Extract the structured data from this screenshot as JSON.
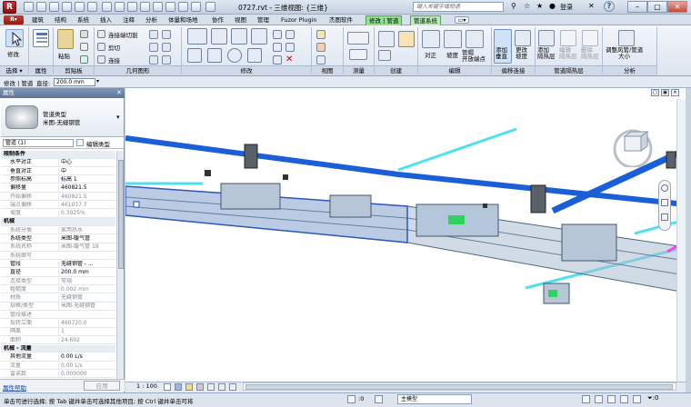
{
  "title_bar": {
    "doc_title": "0727.rvt - 三维视图: {三维}",
    "search_placeholder": "键入关键字或短语",
    "sign_in": "登录",
    "help": "?"
  },
  "tabs": [
    "建筑",
    "结构",
    "系统",
    "插入",
    "注释",
    "分析",
    "体量和场地",
    "协作",
    "视图",
    "管理",
    "Fuzor Plugin",
    "杰图软件",
    "修改 | 管道",
    "管道系统"
  ],
  "ribbon": {
    "panels": [
      {
        "label": "选择 ▾"
      },
      {
        "label": "属性"
      },
      {
        "label": "剪贴板"
      },
      {
        "label": "几何图形"
      },
      {
        "label": "修改"
      },
      {
        "label": "视图"
      },
      {
        "label": "测量"
      },
      {
        "label": "创建"
      },
      {
        "label": "编辑"
      },
      {
        "label": "偏移连接"
      },
      {
        "label": "管道隔热层"
      },
      {
        "label": "分析"
      }
    ],
    "modify_button": "修改",
    "properties_button": "属性",
    "clipboard_paste": "粘贴",
    "geometry": {
      "join_cut": "连接端切割",
      "cut": "剪切",
      "join": "连接"
    },
    "edit": {
      "justify": "对正",
      "slope": "坡度",
      "pipe_open_end": "管帽\n开放端点"
    },
    "offset": {
      "add_vertical": "添加\n垂直",
      "change_slope": "更改\n坡度"
    },
    "insulation": {
      "add": "添加\n隔热层",
      "edit": "编辑\n隔热层",
      "remove": "删除\n隔热层"
    },
    "analysis": {
      "resize": "调整风管/管道\n大小"
    }
  },
  "options_bar": {
    "context": "修改 | 管道",
    "diameter_label": "直径:",
    "diameter_value": "200.0 mm"
  },
  "properties": {
    "palette_title": "属性",
    "type_family": "管道类型",
    "type_name": "米图-无缝钢管",
    "filter_value": "管道 (1)",
    "edit_type": "编辑类型",
    "apply": "应用",
    "help_link": "属性帮助",
    "rows": [
      {
        "k": "限制条件",
        "v": "",
        "kind": "sect"
      },
      {
        "k": "水平对正",
        "v": "中心"
      },
      {
        "k": "垂直对正",
        "v": "中"
      },
      {
        "k": "参照标高",
        "v": "标高 1"
      },
      {
        "k": "偏移量",
        "v": "460821.5"
      },
      {
        "k": "开始偏移",
        "v": "460821.5",
        "kind": "grey"
      },
      {
        "k": "端点偏移",
        "v": "461037.7",
        "kind": "grey"
      },
      {
        "k": "坡度",
        "v": "0.3925%",
        "kind": "grey"
      },
      {
        "k": "机械",
        "v": "",
        "kind": "sect"
      },
      {
        "k": "系统分类",
        "v": "家用热水",
        "kind": "grey"
      },
      {
        "k": "系统类型",
        "v": "米图-暖气管"
      },
      {
        "k": "系统名称",
        "v": "米图-暖气管 18",
        "kind": "grey"
      },
      {
        "k": "系统缩写",
        "v": "",
        "kind": "grey"
      },
      {
        "k": "管段",
        "v": "无缝钢管 - ..."
      },
      {
        "k": "直径",
        "v": "200.0 mm"
      },
      {
        "k": "连接类型",
        "v": "常规",
        "kind": "grey"
      },
      {
        "k": "粗糙度",
        "v": "0.002 mm",
        "kind": "grey"
      },
      {
        "k": "材质",
        "v": "无缝钢管",
        "kind": "grey"
      },
      {
        "k": "规格/类型",
        "v": "米图-无缝钢管",
        "kind": "grey"
      },
      {
        "k": "管段描述",
        "v": "",
        "kind": "grey"
      },
      {
        "k": "投转立面",
        "v": "460720.0",
        "kind": "grey"
      },
      {
        "k": "隔离",
        "v": "1",
        "kind": "grey"
      },
      {
        "k": "面积",
        "v": "24.602",
        "kind": "grey"
      },
      {
        "k": "机械 - 流量",
        "v": "",
        "kind": "sect"
      },
      {
        "k": "其他流量",
        "v": "0.00 L/s"
      },
      {
        "k": "流量",
        "v": "0.00 L/s",
        "kind": "grey"
      },
      {
        "k": "雷诺数",
        "v": "0.000000",
        "kind": "grey"
      }
    ]
  },
  "view_bar": {
    "scale": "1 : 100"
  },
  "status_bar": {
    "message": "单击可进行选择; 按 Tab 键并单击可选择其他项目; 按 Ctrl 键并单击可将",
    "filter_count": ":0",
    "workset": "主模型"
  },
  "colors": {
    "pipe_blue": "#1a5fd8",
    "pipe_cyan": "#4fe0f0",
    "duct_glass": "#7f9ab5",
    "context_tab": "#8fe08f"
  }
}
